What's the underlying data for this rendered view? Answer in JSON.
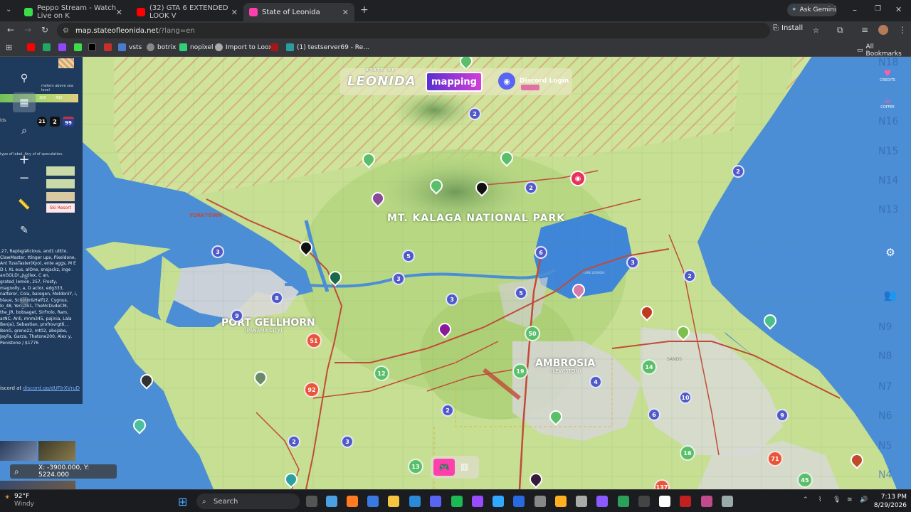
{
  "browser": {
    "tabs": [
      {
        "title": "Peppo Stream - Watch Live on K",
        "favicon_color": "#3ddc49"
      },
      {
        "title": "(32) GTA 6 EXTENDED LOOK V",
        "favicon_color": "#ff0000"
      },
      {
        "title": "State of Leonida",
        "favicon_color": "#ff3fae"
      }
    ],
    "ask_gemini": "Ask Gemini",
    "url_main": "map.stateofleonida.net",
    "url_rest": "/?lang=en",
    "install_label": "Install",
    "bookmarks": [
      "vsts",
      "botrix",
      "nopixel",
      "Import to Loox",
      "(1) testserver69 - Re..."
    ],
    "all_bookmarks": "All Bookmarks"
  },
  "header": {
    "logo_top": "STATE OF",
    "logo_main": "LEONIDA",
    "mapping_label": "mapping",
    "discord_label": "Discord Login"
  },
  "right_buttons": {
    "credits": "CREDITS",
    "coffee": "COFFEE"
  },
  "grid_labels": [
    "N18",
    "N16",
    "N15",
    "N14",
    "N13",
    "N9",
    "N8",
    "N7",
    "N6",
    "N5",
    "N4"
  ],
  "sidepanel": {
    "meters_note": "meters above sea level",
    "scale_low": "300",
    "scale_high": "400",
    "counts": [
      "21",
      "2",
      "99"
    ],
    "label_text": "type of label. Any of of speculation.",
    "tags": [
      "Ski Resort"
    ],
    "credits_text": ".27, Raptexalicious, and1 ulitto, ClawMaster, ttinger upx, Pixeldone, Ant TussTaster(Kyo), ente aggs, M E D I, XL eus, alOne, snsjackz, inge anGOLD!, Juzilex, C an, grated_lemon, 257, Frosty, magnolly, a, D actor, edg333, natterer, Cola, baregen, MeldoniY, i, blaue, Scooter&Half12, Cygnus, lo_48, Yeri_161, TheMcDudeCM, the_JR, bobsaget, SirFrolo, Ram, arNC, Anli, mnm345, pajinia, Lala Benja), Sebastian, profrovrgt6, , BenG, grene22, mt02, abejabe, JayFa, Garza, Thatone200, Alex y, Penistone / $1776",
    "discord_prefix": "iscord at ",
    "discord_link": "discord.gg/dUFJrXVruD"
  },
  "map": {
    "labels": {
      "park": "MT. KALAGA NATIONAL PARK",
      "port": "PORT GELLHORN",
      "port_sub": "(PANAMA CITY)",
      "ambrosia": "AMBROSIA",
      "ambrosia_sub": "(LEWISTON)",
      "yorktown": "YORKTOWN",
      "lake": "LAKE LEONIDA",
      "sands": "SANDS"
    },
    "clusters": [
      {
        "n": "2",
        "color": "#4f5ac8"
      },
      {
        "n": "2",
        "color": "#4f5ac8"
      },
      {
        "n": "2",
        "color": "#4f5ac8"
      },
      {
        "n": "3",
        "color": "#4f5ac8"
      },
      {
        "n": "5",
        "color": "#4f5ac8"
      },
      {
        "n": "3",
        "color": "#4f5ac8"
      },
      {
        "n": "6",
        "color": "#4f5ac8"
      },
      {
        "n": "3",
        "color": "#4f5ac8"
      },
      {
        "n": "2",
        "color": "#4f5ac8"
      },
      {
        "n": "8",
        "color": "#4f5ac8"
      },
      {
        "n": "9",
        "color": "#4f5ac8"
      },
      {
        "n": "3",
        "color": "#4f5ac8"
      },
      {
        "n": "5",
        "color": "#4f5ac8"
      },
      {
        "n": "51",
        "color": "#e8553a"
      },
      {
        "n": "92",
        "color": "#e8553a"
      },
      {
        "n": "12",
        "color": "#5bbf6a"
      },
      {
        "n": "50",
        "color": "#5bbf6a"
      },
      {
        "n": "19",
        "color": "#5bbf6a"
      },
      {
        "n": "14",
        "color": "#5bbf6a"
      },
      {
        "n": "4",
        "color": "#4f5ac8"
      },
      {
        "n": "10",
        "color": "#4f5ac8"
      },
      {
        "n": "6",
        "color": "#4f5ac8"
      },
      {
        "n": "2",
        "color": "#4f5ac8"
      },
      {
        "n": "2",
        "color": "#4f5ac8"
      },
      {
        "n": "3",
        "color": "#4f5ac8"
      },
      {
        "n": "9",
        "color": "#4f5ac8"
      },
      {
        "n": "16",
        "color": "#5bbf6a"
      },
      {
        "n": "71",
        "color": "#e8553a"
      },
      {
        "n": "45",
        "color": "#5bbf6a"
      },
      {
        "n": "13",
        "color": "#5bbf6a"
      },
      {
        "n": "137",
        "color": "#e8553a"
      }
    ],
    "coordinates": "X: -3900.000, Y: 5224.000"
  },
  "taskbar": {
    "temp": "92°F",
    "condition": "Windy",
    "search": "Search",
    "time": "7:13 PM",
    "date": "8/29/2026"
  }
}
